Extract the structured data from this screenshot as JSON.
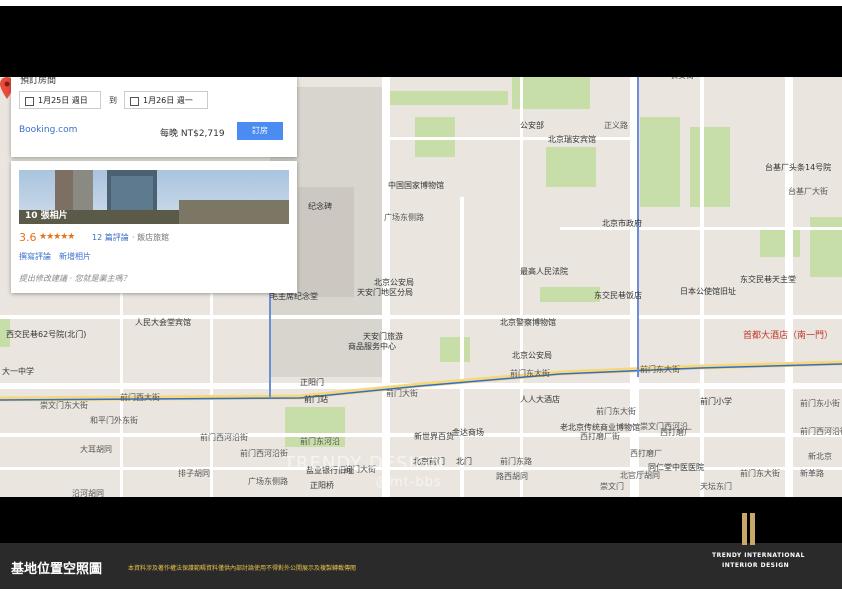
{
  "hotel_card": {
    "rooms_label": "預訂房間",
    "checkin": "1月25日 週日",
    "to": "到",
    "checkout": "1月26日 週一",
    "provider": "Booking.com",
    "price": "每晚 NT$2,719",
    "book_button": "訂房"
  },
  "info_card": {
    "photos_label": "10 張相片",
    "rating": "3.6",
    "stars": "★★★★★",
    "reviews": "12 篇評論",
    "category": "· 飯店旅館",
    "write_review": "撰寫評論",
    "add_photo": "新增相片",
    "owner_prompt": "提出修改建議 · 您就是業主嗎？"
  },
  "map": {
    "selected_place": "首都大酒店（南一門）",
    "labels": [
      {
        "text": "长安街",
        "cls": "road"
      },
      {
        "text": "公安部",
        "cls": ""
      },
      {
        "text": "北京瑞安宾馆",
        "cls": ""
      },
      {
        "text": "正义路",
        "cls": "road"
      },
      {
        "text": "台基厂头条14号院",
        "cls": ""
      },
      {
        "text": "台基厂大街",
        "cls": "road"
      },
      {
        "text": "中国国家博物馆",
        "cls": ""
      },
      {
        "text": "纪念碑",
        "cls": ""
      },
      {
        "text": "广场东侧路",
        "cls": "road"
      },
      {
        "text": "北京市政府",
        "cls": ""
      },
      {
        "text": "最高人民法院",
        "cls": ""
      },
      {
        "text": "北京公安局",
        "cls": ""
      },
      {
        "text": "天安门地区分局",
        "cls": ""
      },
      {
        "text": "东交民巷天主堂",
        "cls": ""
      },
      {
        "text": "毛主席纪念堂",
        "cls": ""
      },
      {
        "text": "东交民巷饭店",
        "cls": ""
      },
      {
        "text": "日本公使馆旧址",
        "cls": ""
      },
      {
        "text": "人民大会堂宾馆",
        "cls": ""
      },
      {
        "text": "北京警察博物馆",
        "cls": ""
      },
      {
        "text": "西交民巷62号院(北门)",
        "cls": ""
      },
      {
        "text": "天安门旅游",
        "cls": ""
      },
      {
        "text": "商品服务中心",
        "cls": ""
      },
      {
        "text": "北京公安局",
        "cls": ""
      },
      {
        "text": "大一中学",
        "cls": ""
      },
      {
        "text": "前门东大街",
        "cls": "road"
      },
      {
        "text": "正阳门",
        "cls": ""
      },
      {
        "text": "前门西大街",
        "cls": "road"
      },
      {
        "text": "前门东大街",
        "cls": "road"
      },
      {
        "text": "前门站",
        "cls": ""
      },
      {
        "text": "前门大街",
        "cls": "road"
      },
      {
        "text": "人人大酒店",
        "cls": ""
      },
      {
        "text": "前门东大街",
        "cls": "road"
      },
      {
        "text": "前门小学",
        "cls": ""
      },
      {
        "text": "前门东小街",
        "cls": "road"
      },
      {
        "text": "崇文门东大街",
        "cls": "road"
      },
      {
        "text": "和平门外东街",
        "cls": "road"
      },
      {
        "text": "老北京传统商业博物馆",
        "cls": ""
      },
      {
        "text": "前门西河沿街",
        "cls": "road"
      },
      {
        "text": "新世界百货",
        "cls": ""
      },
      {
        "text": "金达商场",
        "cls": ""
      },
      {
        "text": "崇文门西河沿",
        "cls": "road"
      },
      {
        "text": "前门东河沿",
        "cls": "road"
      },
      {
        "text": "北京前门",
        "cls": ""
      },
      {
        "text": "北门",
        "cls": ""
      },
      {
        "text": "前门西河沿街",
        "cls": "road"
      },
      {
        "text": "西打磨厂街",
        "cls": "road"
      },
      {
        "text": "西打磨厂",
        "cls": "road"
      },
      {
        "text": "大耳胡同",
        "cls": "road"
      },
      {
        "text": "排子胡同",
        "cls": "road"
      },
      {
        "text": "广场东侧路",
        "cls": "road"
      },
      {
        "text": "西打磨厂",
        "cls": "road"
      },
      {
        "text": "同仁堂中医医院",
        "cls": ""
      },
      {
        "text": "前门东大街",
        "cls": "road"
      },
      {
        "text": "沿河胡同",
        "cls": "road"
      },
      {
        "text": "盐业银行旧址",
        "cls": ""
      },
      {
        "text": "正阳桥",
        "cls": ""
      },
      {
        "text": "前门东路",
        "cls": "road"
      },
      {
        "text": "路西胡同",
        "cls": "road"
      },
      {
        "text": "新革路",
        "cls": "road"
      },
      {
        "text": "北官厅胡同",
        "cls": "road"
      },
      {
        "text": "前门西河沿街",
        "cls": "road"
      },
      {
        "text": "前门大街",
        "cls": "road"
      },
      {
        "text": "崇文门",
        "cls": "road"
      },
      {
        "text": "天坛东门",
        "cls": "road"
      },
      {
        "text": "新北京",
        "cls": "road"
      }
    ]
  },
  "watermark": {
    "line1": "TRENDY DESIGN",
    "line2": "@mt-bbs"
  },
  "footer": {
    "title": "基地位置空照圖",
    "note": "本資料涉及著作權法保護範疇資料僅供內部討論使用不得對外公開展示及複製轉載傳閱",
    "brand_line1": "TRENDY INTERNATIONAL",
    "brand_line2": "INTERIOR DESIGN",
    "accent": "#c8a76a"
  }
}
